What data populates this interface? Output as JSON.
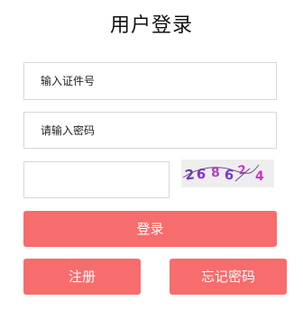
{
  "page": {
    "title": "用户登录"
  },
  "form": {
    "id_number_placeholder": "输入证件号",
    "password_placeholder": "请输入密码",
    "captcha_value": "",
    "captcha_text": "26862 4"
  },
  "buttons": {
    "login_label": "登录",
    "register_label": "注册",
    "forgot_label": "忘记密码"
  },
  "colors": {
    "button_bg": "#f76c6c",
    "captcha_purple": "#8a2be2",
    "captcha_magenta": "#cc33cc"
  }
}
